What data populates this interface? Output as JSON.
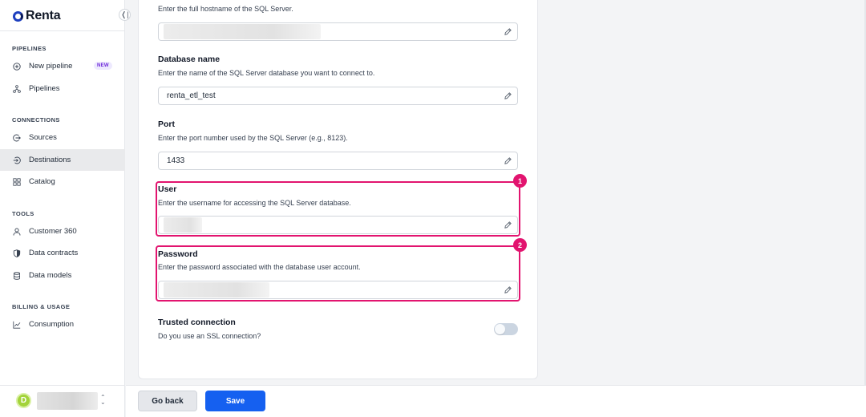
{
  "app": {
    "name": "Renta"
  },
  "sidebar": {
    "sections": [
      {
        "label": "PIPELINES"
      },
      {
        "label": "CONNECTIONS"
      },
      {
        "label": "TOOLS"
      },
      {
        "label": "BILLING & USAGE"
      }
    ],
    "items": [
      {
        "label": "New pipeline",
        "icon": "plus-circle-icon",
        "badge": "NEW"
      },
      {
        "label": "Pipelines",
        "icon": "pipelines-icon"
      },
      {
        "label": "Sources",
        "icon": "sources-icon"
      },
      {
        "label": "Destinations",
        "icon": "destinations-icon",
        "active": true
      },
      {
        "label": "Catalog",
        "icon": "catalog-icon"
      },
      {
        "label": "Customer 360",
        "icon": "user-icon"
      },
      {
        "label": "Data contracts",
        "icon": "shield-icon"
      },
      {
        "label": "Data models",
        "icon": "database-icon"
      },
      {
        "label": "Consumption",
        "icon": "chart-icon"
      }
    ],
    "avatar_initial": "D"
  },
  "form": {
    "hostname": {
      "description": "Enter the full hostname of the SQL Server."
    },
    "database": {
      "title": "Database name",
      "description": "Enter the name of the SQL Server database you want to connect to.",
      "value": "renta_etl_test"
    },
    "port": {
      "title": "Port",
      "description": "Enter the port number used by the SQL Server (e.g., 8123).",
      "value": "1433"
    },
    "user": {
      "title": "User",
      "description": "Enter the username for accessing the SQL Server database.",
      "marker": "1"
    },
    "password": {
      "title": "Password",
      "description": "Enter the password associated with the database user account.",
      "marker": "2"
    },
    "trusted": {
      "title": "Trusted connection",
      "description": "Do you use an SSL connection?",
      "enabled": false
    }
  },
  "footer": {
    "back_label": "Go back",
    "save_label": "Save"
  },
  "colors": {
    "accent": "#1560f0",
    "highlight": "#e2146f",
    "active_nav": "#e9eaec"
  }
}
